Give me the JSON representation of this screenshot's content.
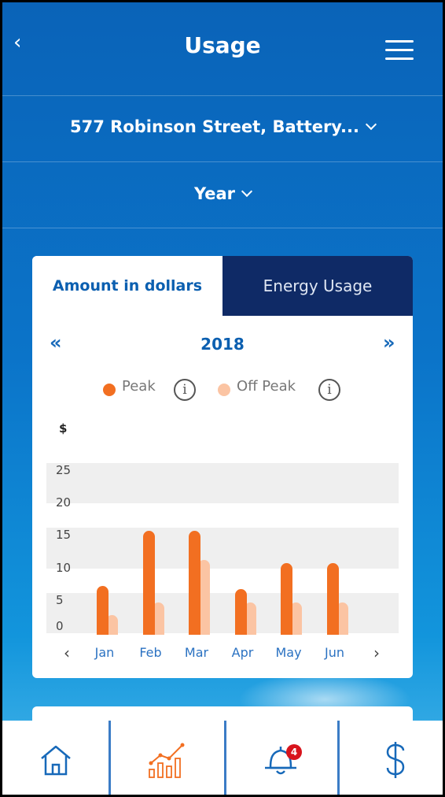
{
  "header": {
    "title": "Usage",
    "back_glyph": "‹",
    "menu_icon": "hamburger-menu-icon"
  },
  "selectors": {
    "address": "577 Robinson Street, Battery...",
    "period": "Year"
  },
  "tabs": [
    {
      "label": "Amount in dollars",
      "active": true
    },
    {
      "label": "Energy Usage",
      "active": false
    }
  ],
  "year_nav": {
    "prev_glyph": "«",
    "year": "2018",
    "next_glyph": "»"
  },
  "legend": [
    {
      "label": "Peak",
      "color": "#f26f21",
      "info_glyph": "i"
    },
    {
      "label": "Off Peak",
      "color": "#fbc4a3",
      "info_glyph": "i"
    }
  ],
  "chart_data": {
    "type": "bar",
    "ylabel": "$",
    "ylim": [
      0,
      25
    ],
    "yticks": [
      "25",
      "20",
      "15",
      "10",
      "5",
      "0"
    ],
    "categories": [
      "Jan",
      "Feb",
      "Mar",
      "Apr",
      "May",
      "Jun"
    ],
    "series": [
      {
        "name": "Peak",
        "color": "#f26f21",
        "values": [
          7.5,
          16,
          16,
          7,
          11,
          11
        ]
      },
      {
        "name": "Off Peak",
        "color": "#fbc4a3",
        "values": [
          3,
          5,
          11.5,
          5,
          5,
          5
        ]
      }
    ],
    "prev_glyph": "‹",
    "next_glyph": "›"
  },
  "bottom_nav": {
    "items": [
      {
        "icon": "home-icon",
        "active": false
      },
      {
        "icon": "usage-chart-icon",
        "active": true
      },
      {
        "icon": "notification-bell-icon",
        "badge": "4",
        "active": false
      },
      {
        "icon": "dollar-icon",
        "active": false
      }
    ],
    "accent": "#1769b9",
    "active_color": "#f26f21",
    "badge_color": "#d8141c"
  }
}
